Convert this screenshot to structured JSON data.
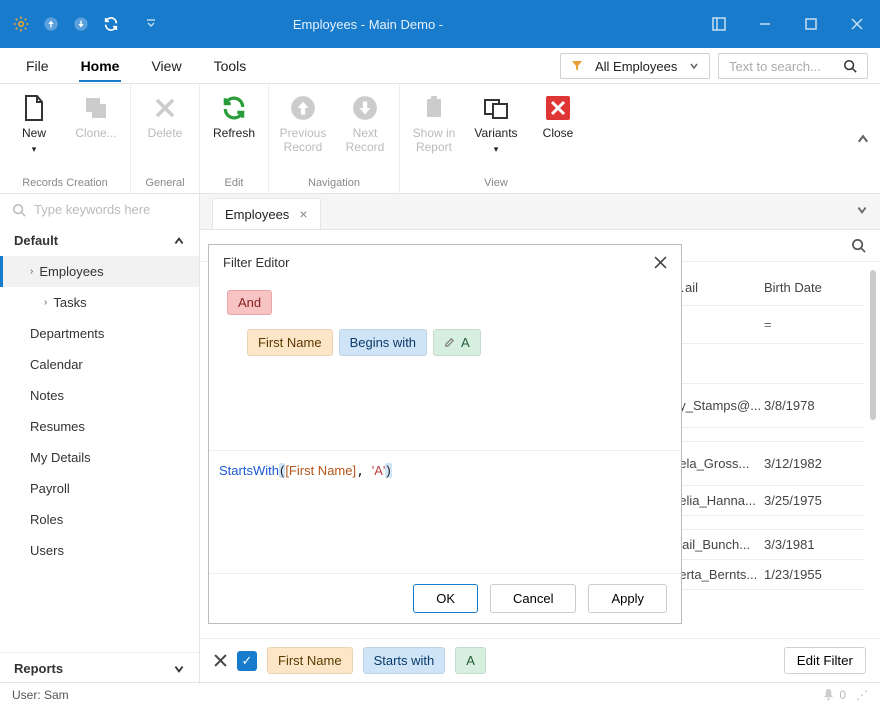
{
  "window": {
    "title": "Employees - Main Demo -"
  },
  "menu": {
    "file": "File",
    "home": "Home",
    "view": "View",
    "tools": "Tools",
    "filter_dropdown": "All Employees",
    "search_placeholder": "Text to search..."
  },
  "ribbon": {
    "new": "New",
    "clone": "Clone...",
    "delete": "Delete",
    "refresh": "Refresh",
    "previous_record": "Previous\nRecord",
    "next_record": "Next\nRecord",
    "show_in_report": "Show in\nReport",
    "variants": "Variants",
    "close": "Close",
    "group_records_creation": "Records Creation",
    "group_general": "General",
    "group_edit": "Edit",
    "group_navigation": "Navigation",
    "group_view": "View"
  },
  "sidebar": {
    "search_placeholder": "Type keywords here",
    "default_label": "Default",
    "items": {
      "employees": "Employees",
      "tasks": "Tasks",
      "departments": "Departments",
      "calendar": "Calendar",
      "notes": "Notes",
      "resumes": "Resumes",
      "my_details": "My Details",
      "payroll": "Payroll",
      "roles": "Roles",
      "users": "Users"
    },
    "reports_label": "Reports"
  },
  "tab": {
    "employees": "Employees"
  },
  "grid": {
    "col_email": "…ail",
    "col_birth_date": "Birth Date",
    "filter_eq": "=",
    "rows": [
      {
        "email": "ny_Stamps@...",
        "date": "3/8/1978"
      },
      {
        "email": "gela_Gross...",
        "date": "3/12/1982"
      },
      {
        "email": "gelia_Hanna...",
        "date": "3/25/1975"
      },
      {
        "email": "igail_Bunch...",
        "date": "3/3/1981"
      },
      {
        "email": "berta_Bernts...",
        "date": "1/23/1955"
      }
    ]
  },
  "filter_editor": {
    "title": "Filter Editor",
    "and": "And",
    "field": "First Name",
    "operator": "Begins with",
    "value": "A",
    "expr_fn": "StartsWith",
    "expr_col": "[First Name]",
    "expr_lit": "'A'",
    "ok": "OK",
    "cancel": "Cancel",
    "apply": "Apply"
  },
  "filterbar": {
    "field": "First Name",
    "operator": "Starts with",
    "value": "A",
    "edit_filter": "Edit Filter"
  },
  "status": {
    "user": "User: Sam",
    "notifications": "0"
  },
  "colors": {
    "accent": "#187bcc"
  }
}
